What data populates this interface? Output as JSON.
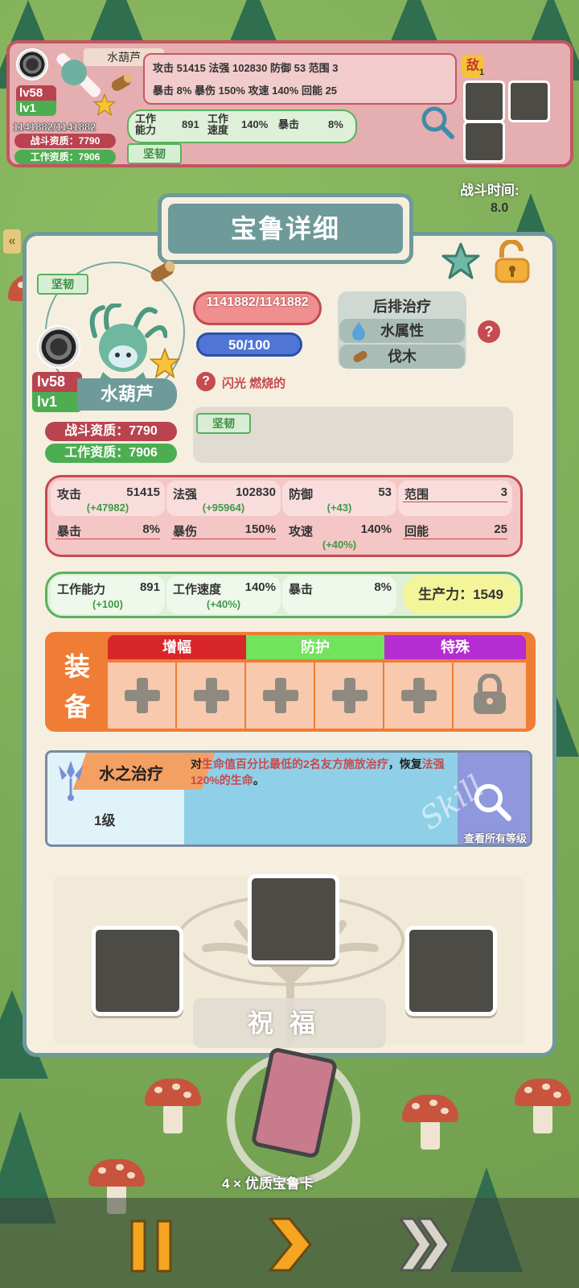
{
  "top_summary": {
    "name": "水葫芦",
    "level_battle": "lv58",
    "level_work": "lv1",
    "hp": "1141882/1141882",
    "battle_aptitude": "战斗资质：7790",
    "work_aptitude": "工作资质：7906",
    "row1": "攻击   51415 法强 102830 防御        53 范围          3",
    "row2": "暴击        8% 暴伤      150% 攻速      140% 回能        25",
    "work_label": "工作\n能力",
    "work_value": "891",
    "speed_label": "工作\n速度",
    "speed_value": "140%",
    "crit_label": "暴击",
    "crit_value": "8%",
    "trait_tag": "坚韧",
    "enemy_label": "敌",
    "enemy_count": "1"
  },
  "battle_time": {
    "label": "战斗时间:",
    "value": "8.0"
  },
  "modal": {
    "title": "宝鲁详细",
    "trait_tag": "坚韧",
    "level_battle": "lv58",
    "level_work": "lv1",
    "name": "水葫芦",
    "battle_aptitude": "战斗资质：7790",
    "work_aptitude": "工作资质：7906",
    "hp": "1141882/1141882",
    "mp": "50/100",
    "traits_text": "闪光 燃烧的",
    "role": "后排治疗",
    "element": "水属性",
    "skill_type": "伐木",
    "passive_tag": "坚韧",
    "stats": [
      {
        "label": "攻击",
        "value": "51415",
        "bonus": "(+47982)"
      },
      {
        "label": "法强",
        "value": "102830",
        "bonus": "(+95964)"
      },
      {
        "label": "防御",
        "value": "53",
        "bonus": "(+43)"
      },
      {
        "label": "范围",
        "value": "3",
        "bonus": ""
      },
      {
        "label": "暴击",
        "value": "8%",
        "bonus": ""
      },
      {
        "label": "暴伤",
        "value": "150%",
        "bonus": ""
      },
      {
        "label": "攻速",
        "value": "140%",
        "bonus": "(+40%)"
      },
      {
        "label": "回能",
        "value": "25",
        "bonus": ""
      }
    ],
    "work_stats": [
      {
        "label": "工作能力",
        "value": "891",
        "bonus": "(+100)"
      },
      {
        "label": "工作速度",
        "value": "140%",
        "bonus": "(+40%)"
      },
      {
        "label": "暴击",
        "value": "8%",
        "bonus": ""
      }
    ],
    "productivity": "生产力：1549",
    "equip": {
      "label_1": "装",
      "label_2": "备",
      "cat_amplify": "增幅",
      "cat_protect": "防护",
      "cat_special": "特殊"
    },
    "skill": {
      "name": "水之治疗",
      "level": "1级",
      "desc_1": "对",
      "desc_hl1": "生命值百分比最低的2名友方施放治疗",
      "desc_2": "，恢复",
      "desc_hl2": "法强120%的生命",
      "desc_3": "。",
      "watermark": "Skill",
      "view_all": "查看所有等级"
    },
    "bless_label": "祝福"
  },
  "bottom": {
    "card_count": "4 × 优质宝鲁卡",
    "pause_icon": "pause-icon",
    "play_icon": "play-icon",
    "fast_icon": "fast-forward-icon"
  },
  "colors": {
    "teal": "#6e9a9a",
    "red": "#c64a4f",
    "green": "#5ab15c",
    "orange": "#ef7d36",
    "amplify": "#d8262b",
    "protect": "#72e35c",
    "special": "#b52cd2"
  }
}
